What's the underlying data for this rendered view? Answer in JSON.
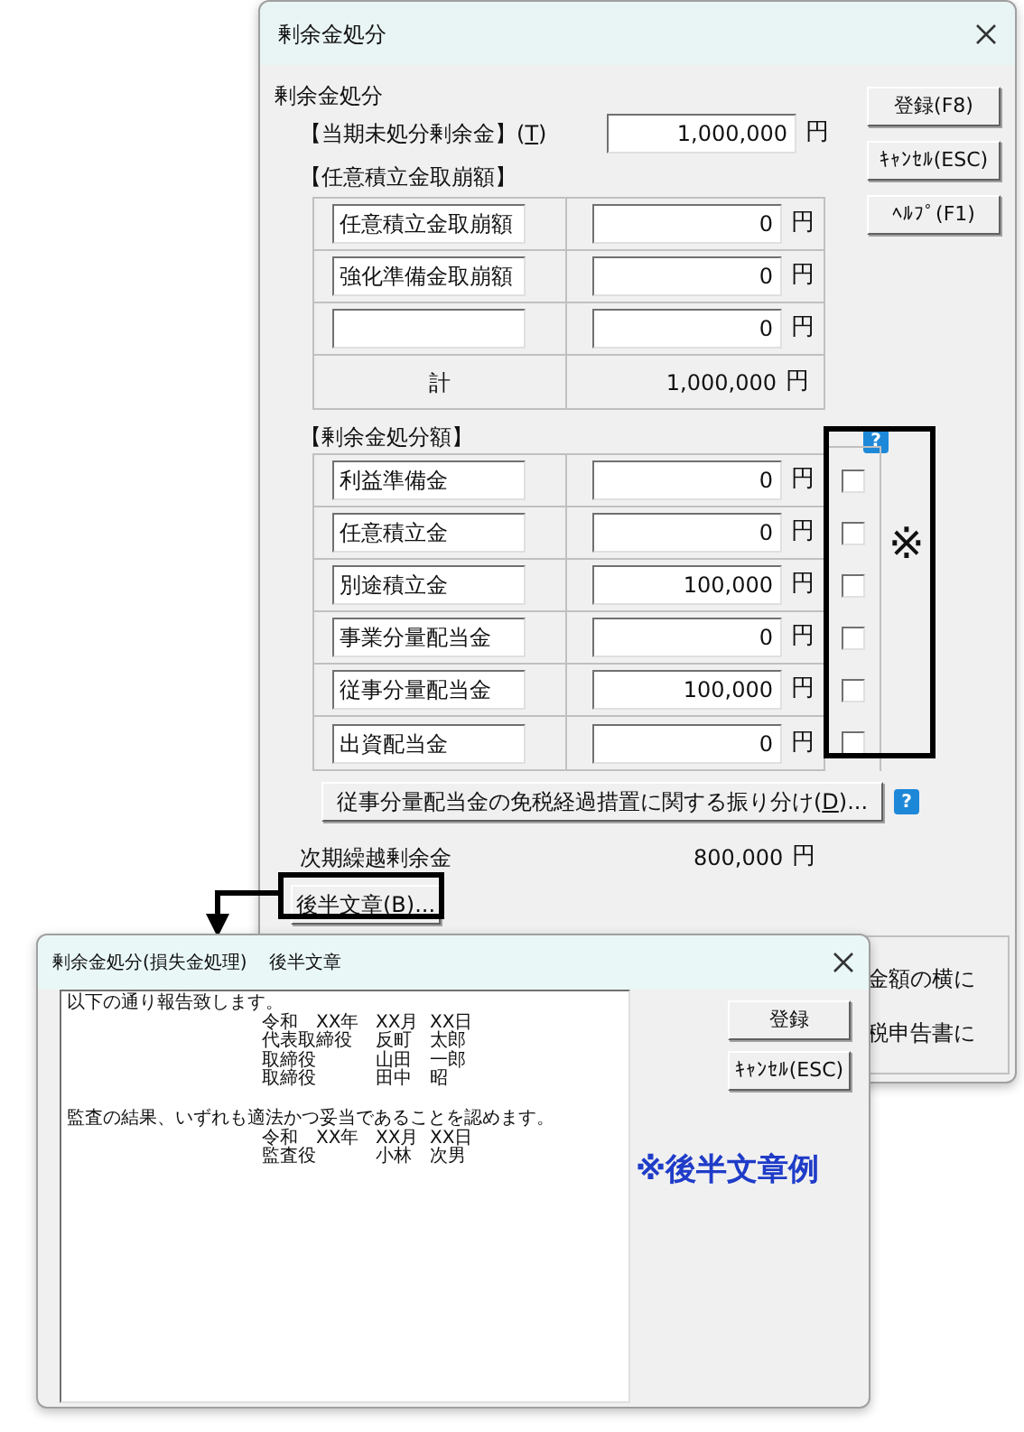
{
  "main_dialog": {
    "title": "剰余金処分",
    "section_label": "剰余金処分",
    "unappropriated": {
      "label_parts": [
        "【当期未処分剰余金】(",
        "T",
        ")"
      ],
      "value": "1,000,000",
      "unit": "円"
    },
    "buttons": [
      "登録(F8)",
      "ｷｬﾝｾﾙ(ESC)",
      "ﾍﾙﾌﾟ(F1)"
    ],
    "withdrawals": {
      "heading": "【任意積立金取崩額】",
      "rows": [
        {
          "name": "任意積立金取崩額",
          "value": "0",
          "unit": "円"
        },
        {
          "name": "強化準備金取崩額",
          "value": "0",
          "unit": "円"
        },
        {
          "value": "0",
          "unit": "円"
        }
      ],
      "total": {
        "label": "計",
        "value": "1,000,000",
        "unit": "円"
      }
    },
    "disposal": {
      "heading": "【剰余金処分額】",
      "help_badge": "?",
      "rows": [
        {
          "name": "利益準備金",
          "value": "0",
          "unit": "円",
          "checked": false
        },
        {
          "name": "任意積立金",
          "value": "0",
          "unit": "円",
          "checked": false
        },
        {
          "name": "別途積立金",
          "value": "100,000",
          "unit": "円",
          "checked": false
        },
        {
          "name": "事業分量配当金",
          "value": "0",
          "unit": "円",
          "checked": false
        },
        {
          "name": "従事分量配当金",
          "value": "100,000",
          "unit": "円",
          "checked": false
        },
        {
          "name": "出資配当金",
          "value": "0",
          "unit": "円",
          "checked": false
        }
      ]
    },
    "allocation_button": {
      "label_parts": [
        "従事分量配当金の免税経過措置に関する振り分け(",
        "D",
        ")..."
      ],
      "help_badge": "?"
    },
    "carry_forward": {
      "label": "次期繰越剰余金",
      "value": "800,000",
      "unit": "円"
    },
    "latter_text_button": {
      "label_parts": [
        "後半文章(",
        "B",
        ")..."
      ]
    },
    "group_texts": [
      "金額の横に",
      "税申告書に"
    ]
  },
  "sub_dialog": {
    "title": "剰余金処分(損失金処理)",
    "subtitle": "後半文章",
    "buttons": [
      "登録",
      "ｷｬﾝｾﾙ(ESC)"
    ],
    "text_lines": [
      {
        "kind": "plain",
        "text": "以下の通り報告致します。"
      },
      {
        "kind": "signature",
        "cells": [
          "令和　XX年",
          "XX月",
          "XX日"
        ]
      },
      {
        "kind": "signature",
        "cells": [
          "代表取締役",
          "反町",
          "太郎"
        ]
      },
      {
        "kind": "signature",
        "cells": [
          "取締役",
          "山田",
          "一郎"
        ]
      },
      {
        "kind": "signature",
        "cells": [
          "取締役",
          "田中",
          "昭"
        ]
      },
      {
        "kind": "blank"
      },
      {
        "kind": "plain",
        "text": "監査の結果、いずれも適法かつ妥当であることを認めます。"
      },
      {
        "kind": "signature",
        "cells": [
          "令和　XX年",
          "XX月",
          "XX日"
        ]
      },
      {
        "kind": "signature",
        "cells": [
          "監査役",
          "小林",
          "次男"
        ]
      }
    ]
  },
  "annotations": {
    "mark": "※",
    "caption": "※後半文章例"
  }
}
